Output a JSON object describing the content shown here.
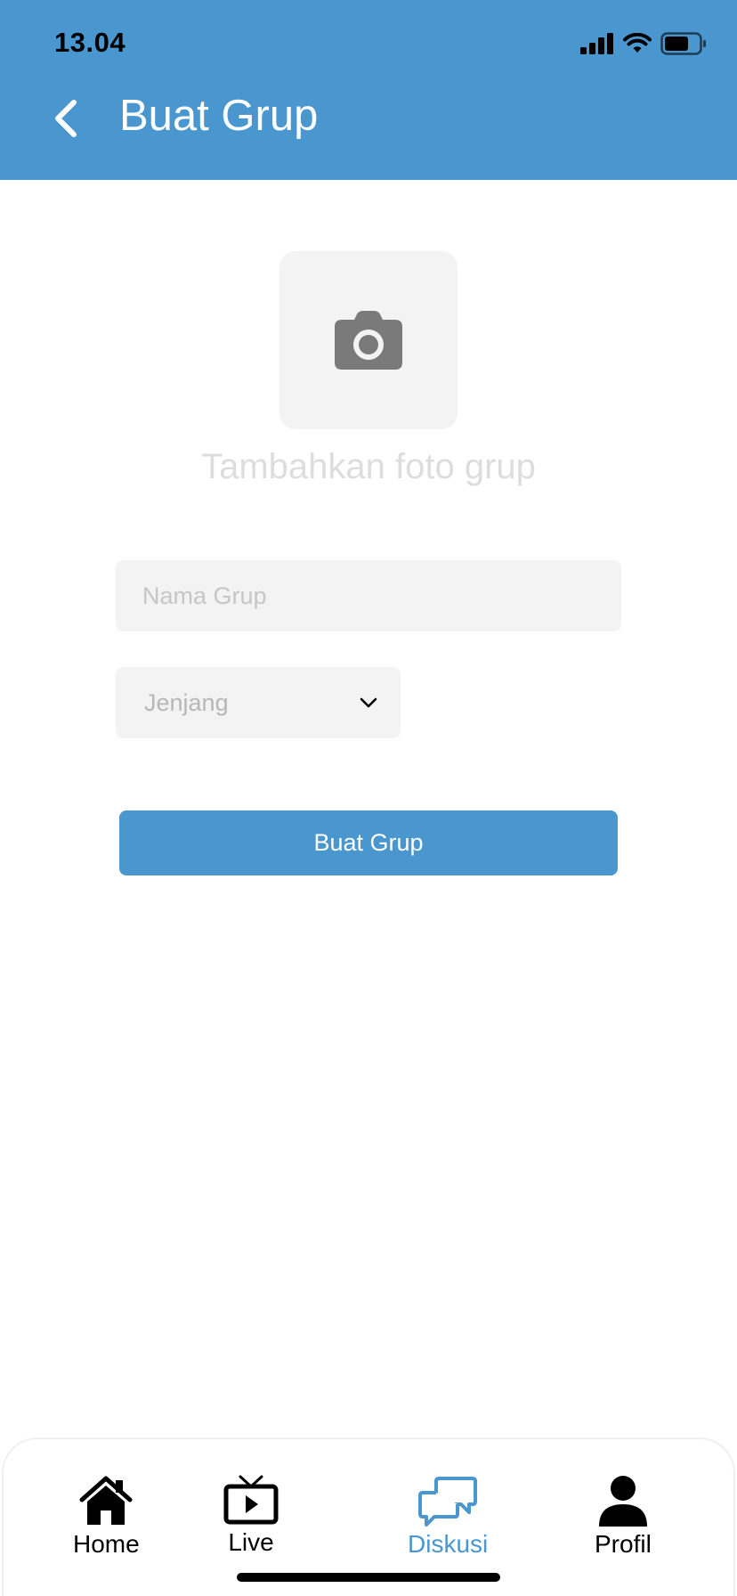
{
  "status_bar": {
    "time": "13.04"
  },
  "header": {
    "title": "Buat Grup",
    "back_icon": "chevron-left-icon"
  },
  "photo": {
    "icon": "camera-icon",
    "caption": "Tambahkan foto grup"
  },
  "form": {
    "name_placeholder": "Nama Grup",
    "name_value": "",
    "level_selected": "Jenjang",
    "submit_label": "Buat Grup"
  },
  "bottom_nav": {
    "items": [
      {
        "label": "Home",
        "icon": "home-icon"
      },
      {
        "label": "Live",
        "icon": "tv-play-icon"
      },
      {
        "label": "Diskusi",
        "icon": "chat-bubbles-icon"
      },
      {
        "label": "Profil",
        "icon": "person-icon"
      }
    ],
    "active_index": 2
  },
  "colors": {
    "primary": "#4A96CF",
    "field_bg": "#F3F3F3",
    "placeholder": "#C6C6C6"
  }
}
